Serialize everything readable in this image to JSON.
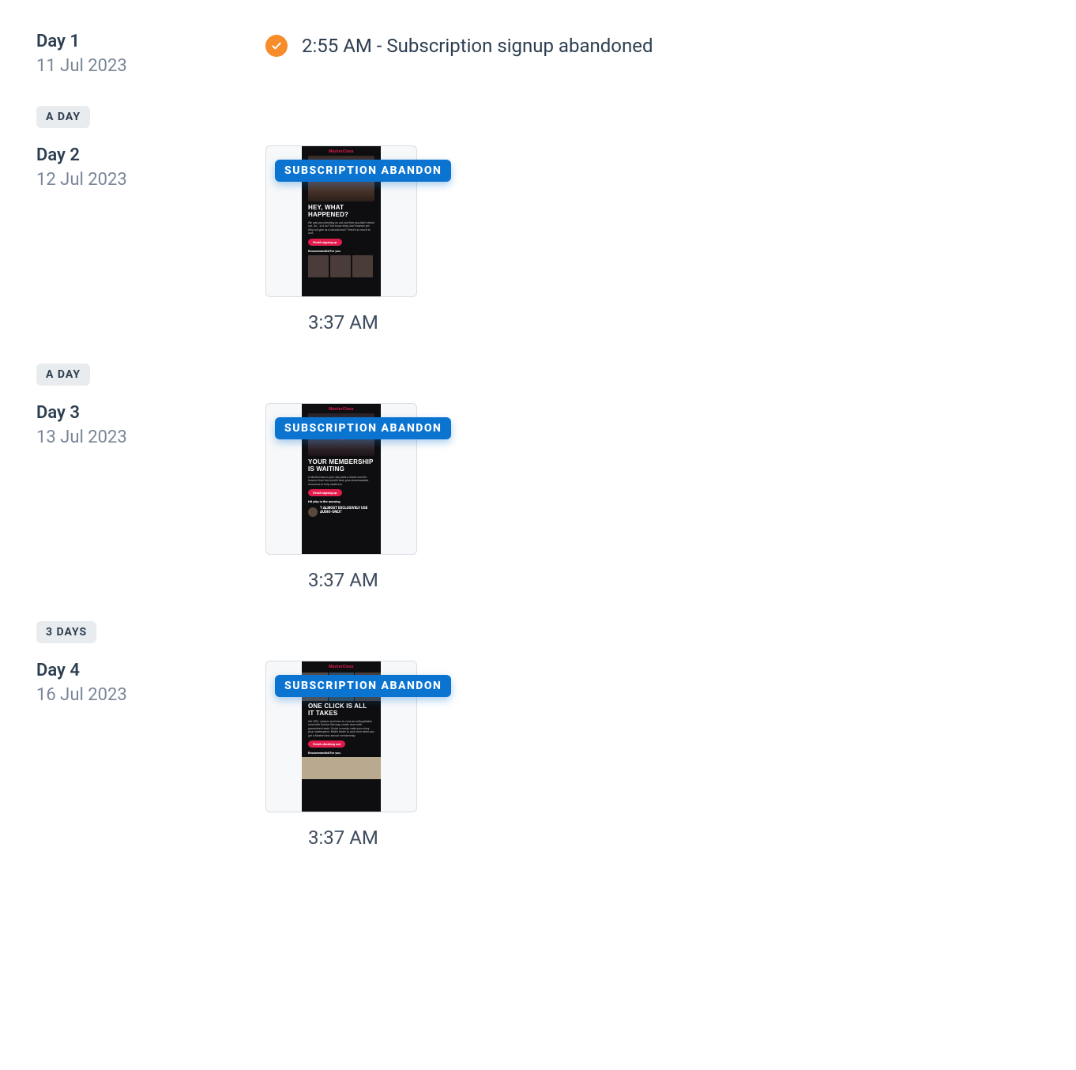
{
  "days": [
    {
      "label": "Day 1",
      "date": "11 Jul 2023",
      "event_text": "2:55 AM - Subscription signup abandoned",
      "gap_after": "A DAY"
    },
    {
      "label": "Day 2",
      "date": "12 Jul 2023",
      "email": {
        "badge": "SUBSCRIPTION ABANDON",
        "headline": "HEY, WHAT HAPPENED?",
        "sub": "Recommended for you",
        "time": "3:37 AM"
      },
      "gap_after": "A DAY"
    },
    {
      "label": "Day 3",
      "date": "13 Jul 2023",
      "email": {
        "badge": "SUBSCRIPTION ABANDON",
        "headline": "YOUR MEMBERSHIP IS WAITING",
        "sub": "Hit play in the morning",
        "quote": "\"I ALMOST EXCLUSIVELY USE AUDIO-ONLY.\"",
        "time": "3:37 AM"
      },
      "gap_after": "3 DAYS"
    },
    {
      "label": "Day 4",
      "date": "16 Jul 2023",
      "email": {
        "badge": "SUBSCRIPTION ABANDON",
        "headline": "ONE CLICK IS ALL IT TAKES",
        "sub": "Recommended for you",
        "time": "3:37 AM"
      }
    }
  ]
}
